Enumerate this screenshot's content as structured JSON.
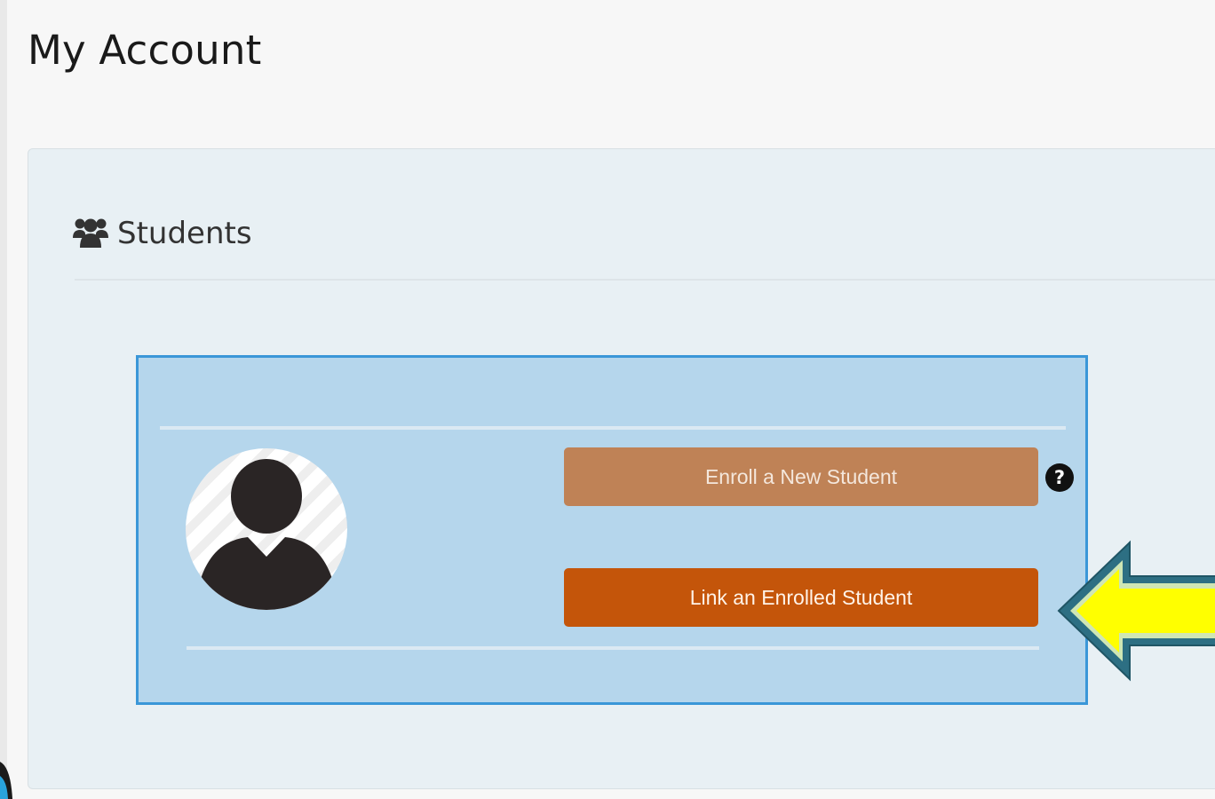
{
  "page": {
    "title": "My Account"
  },
  "students_panel": {
    "heading": "Students",
    "heading_icon": "users-icon",
    "card": {
      "avatar_icon": "user-avatar-placeholder-icon",
      "enroll_button_label": "Enroll a New Student",
      "link_button_label": "Link an Enrolled Student",
      "help_icon": "help-icon",
      "help_glyph": "?"
    }
  },
  "annotation": {
    "icon": "yellow-arrow-pointing-left"
  },
  "colors": {
    "page_bg": "#f7f7f7",
    "panel_bg": "#e8f0f4",
    "card_bg": "#b5d6ec",
    "card_border": "#3a97d8",
    "enroll_button": "#bf8256",
    "link_button": "#c4550a",
    "arrow_fill": "#ffff00",
    "arrow_outline": "#2d6f83"
  }
}
